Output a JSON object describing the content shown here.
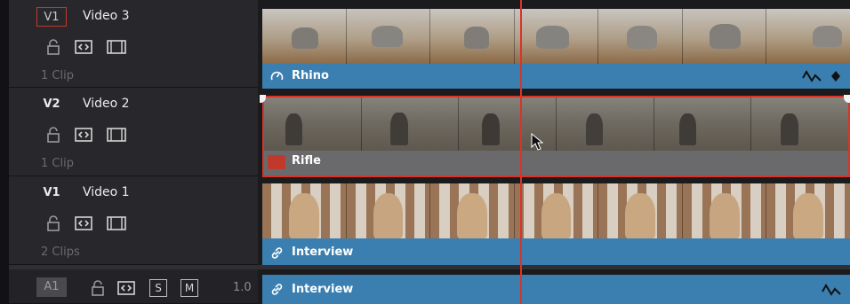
{
  "tracks": [
    {
      "id": "V1",
      "name": "Video 3",
      "clips": "1 Clip",
      "clip_name": "Rhino"
    },
    {
      "id": "V2",
      "name": "Video 2",
      "clips": "1 Clip",
      "clip_name": "Rifle"
    },
    {
      "id": "V1",
      "name": "Video 1",
      "clips": "2 Clips",
      "clip_name": "Interview"
    }
  ],
  "audio": {
    "id": "A1",
    "solo": "S",
    "mute": "M",
    "level": "1.0",
    "clip_name": "Interview"
  },
  "colors": {
    "video_clip": "#3b7fb0",
    "selected_outline": "#d8342a",
    "playhead": "#d8342a",
    "rifle_clip": "#6a6a6c"
  },
  "icons": [
    "lock-icon",
    "autoselect-icon",
    "display-icon",
    "speed-icon",
    "link-icon",
    "curve-icon",
    "keyframe-icon",
    "color-tag-icon",
    "cursor-icon"
  ]
}
